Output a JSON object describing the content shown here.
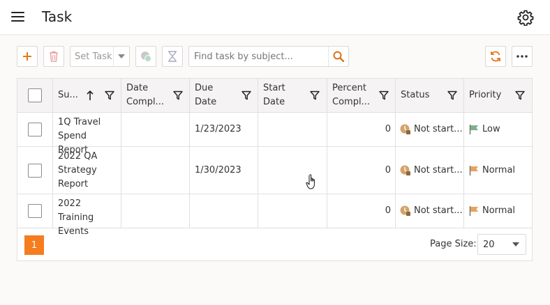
{
  "header": {
    "title": "Task",
    "menu_icon": "hamburger-menu-icon",
    "settings_icon": "gear-icon"
  },
  "toolbar": {
    "add_icon": "plus-icon",
    "delete_icon": "trash-icon",
    "set_task_label": "Set Task",
    "link_icon": "link-task-icon",
    "clear_filter_icon": "hourglass-icon",
    "search_placeholder": "Find task by subject...",
    "search_icon": "search-icon",
    "refresh_icon": "refresh-icon",
    "more_icon": "ellipsis-icon"
  },
  "grid": {
    "columns": [
      {
        "key": "subject",
        "label": "Su...",
        "sorted": "ascending"
      },
      {
        "key": "date_completed",
        "label": "Date Compl..."
      },
      {
        "key": "due_date",
        "label": "Due Date"
      },
      {
        "key": "start_date",
        "label": "Start Date"
      },
      {
        "key": "percent_complete",
        "label": "Percent Compl..."
      },
      {
        "key": "status",
        "label": "Status"
      },
      {
        "key": "priority",
        "label": "Priority"
      }
    ],
    "rows": [
      {
        "subject": "1Q Travel Spend Report",
        "date_completed": "",
        "due_date": "1/23/2023",
        "start_date": "",
        "percent_complete": "0",
        "status": "Not start...",
        "priority": "Low",
        "priority_color": "#7fb08a"
      },
      {
        "subject": "2022 QA Strategy Report",
        "date_completed": "",
        "due_date": "1/30/2023",
        "start_date": "",
        "percent_complete": "0",
        "status": "Not start...",
        "priority": "Normal",
        "priority_color": "#e8a25c"
      },
      {
        "subject": "2022 Training Events",
        "date_completed": "",
        "due_date": "",
        "start_date": "",
        "percent_complete": "0",
        "status": "Not start...",
        "priority": "Normal",
        "priority_color": "#e8a25c"
      }
    ]
  },
  "pager": {
    "current_page": "1",
    "page_size_label": "Page Size:",
    "page_size": "20"
  },
  "colors": {
    "accent": "#f57c1f",
    "trash": "#e8a0a0"
  }
}
